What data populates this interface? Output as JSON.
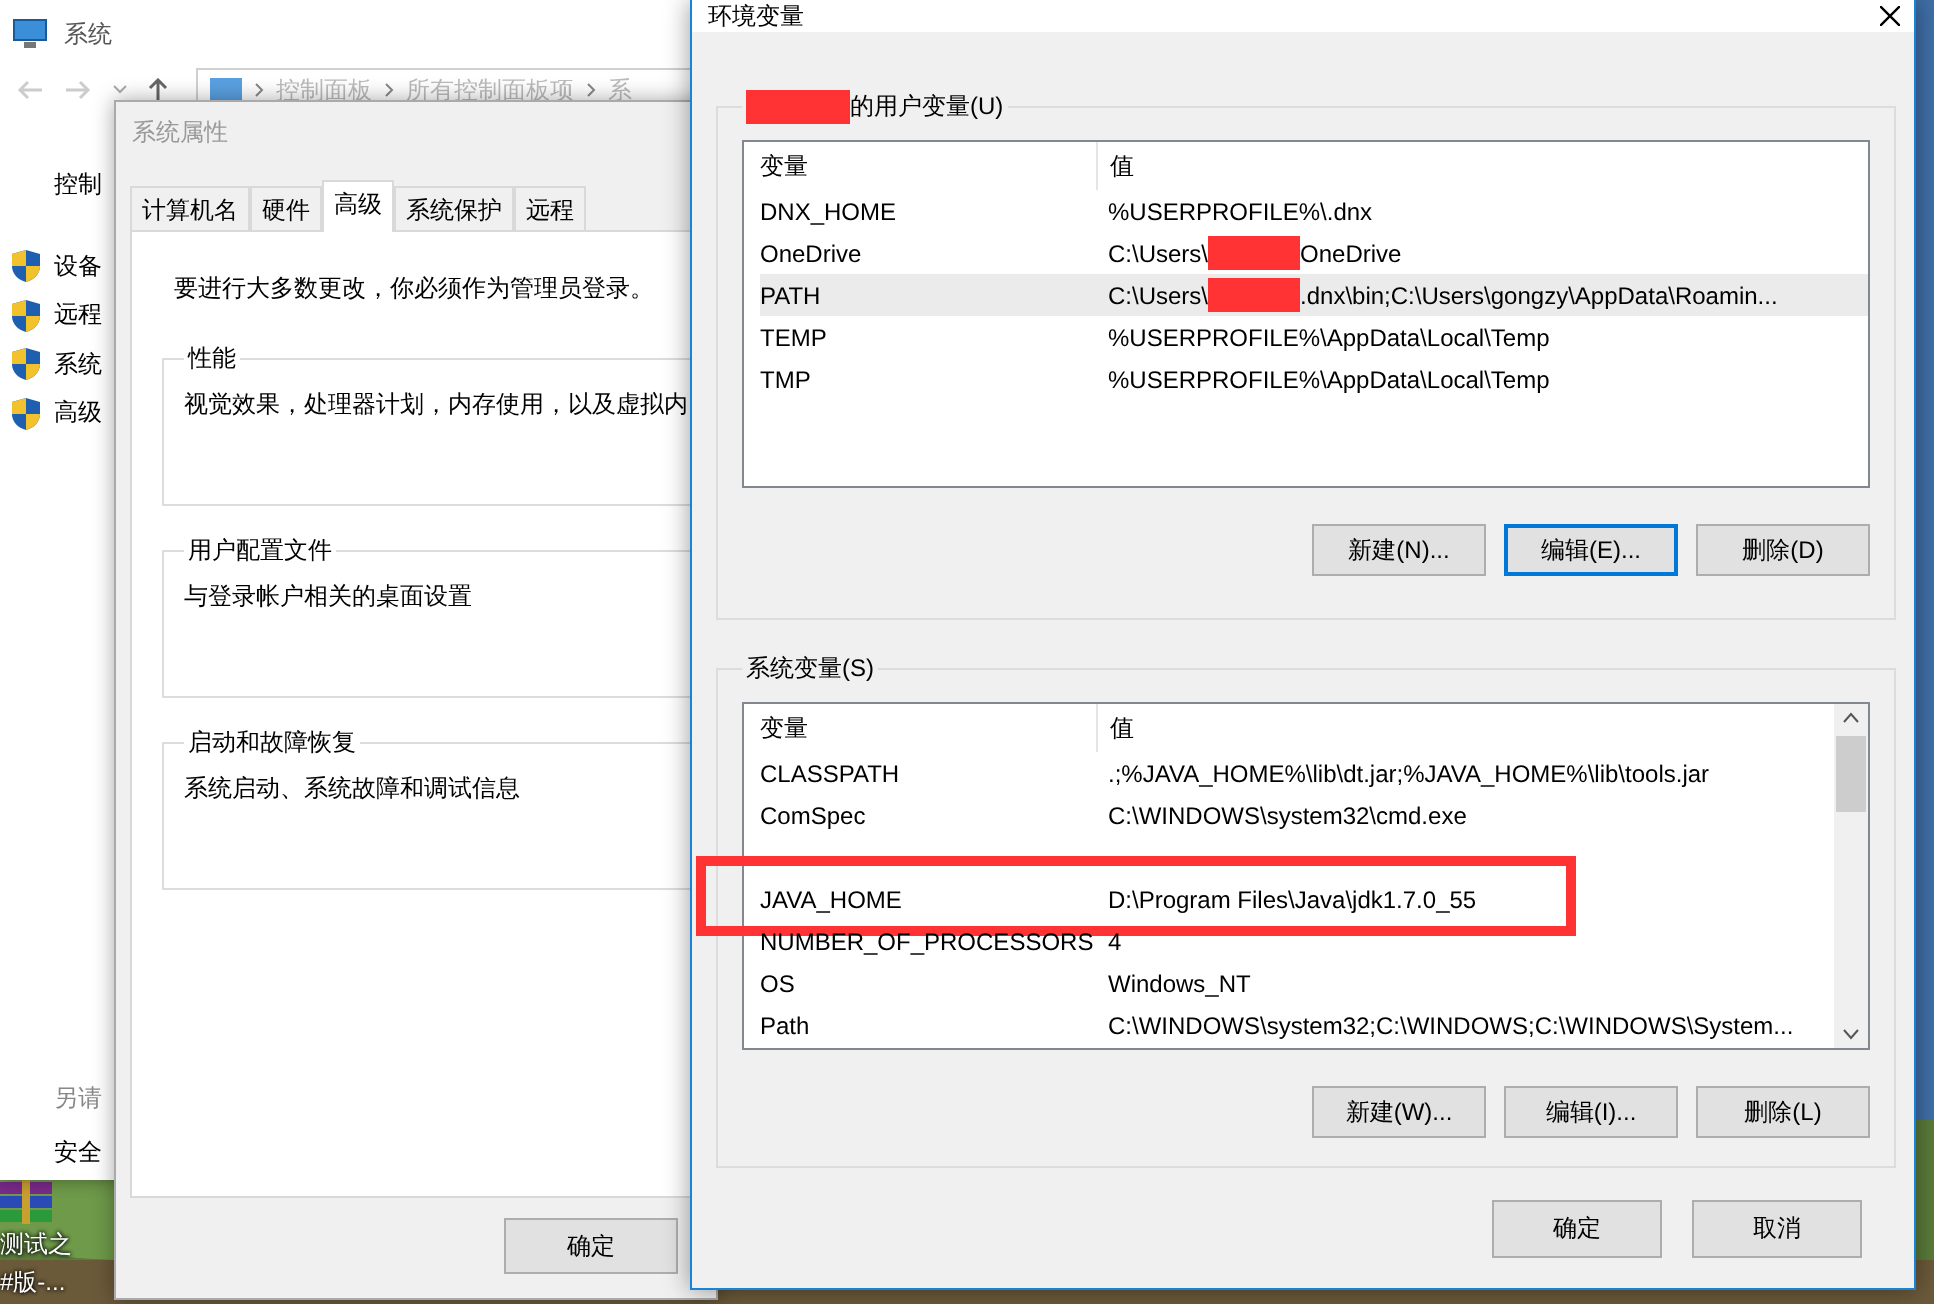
{
  "desktop": {
    "icons": [
      {
        "label": "测试之"
      },
      {
        "label": "#版-..."
      }
    ]
  },
  "control_panel": {
    "title": "系统",
    "breadcrumb": [
      "控制面板",
      "所有控制面板项",
      "系"
    ],
    "home_link": "控制",
    "tasks": [
      {
        "label": "设备"
      },
      {
        "label": "远程"
      },
      {
        "label": "系统"
      },
      {
        "label": "高级"
      }
    ],
    "see_also": {
      "heading": "另请",
      "links": [
        "安全"
      ]
    }
  },
  "system_properties": {
    "title": "系统属性",
    "tabs": [
      {
        "label": "计算机名",
        "selected": false
      },
      {
        "label": "硬件",
        "selected": false
      },
      {
        "label": "高级",
        "selected": true
      },
      {
        "label": "系统保护",
        "selected": false
      },
      {
        "label": "远程",
        "selected": false
      }
    ],
    "notice": "要进行大多数更改，你必须作为管理员登录。",
    "groups": [
      {
        "title": "性能",
        "text": "视觉效果，处理器计划，内存使用，以及虚拟内"
      },
      {
        "title": "用户配置文件",
        "text": "与登录帐户相关的桌面设置"
      },
      {
        "title": "启动和故障恢复",
        "text": "系统启动、系统故障和调试信息"
      }
    ],
    "buttons": [
      "确定"
    ]
  },
  "environment_variables": {
    "title": "环境变量",
    "user_variables": {
      "label": "的用户变量(U)",
      "label_redacted": true,
      "columns": [
        "变量",
        "值"
      ],
      "rows": [
        {
          "name": "DNX_HOME",
          "value": "%USERPROFILE%\\.dnx",
          "selected": false
        },
        {
          "name": "OneDrive",
          "value": "C:\\Users\\",
          "redacted": true,
          "value_tail": "OneDrive",
          "selected": false
        },
        {
          "name": "PATH",
          "value": "C:\\Users\\",
          "redacted": true,
          "value_tail": ".dnx\\bin;C:\\Users\\gongzy\\AppData\\Roamin...",
          "selected": true
        },
        {
          "name": "TEMP",
          "value": "%USERPROFILE%\\AppData\\Local\\Temp",
          "selected": false
        },
        {
          "name": "TMP",
          "value": "%USERPROFILE%\\AppData\\Local\\Temp",
          "selected": false
        }
      ],
      "buttons": [
        {
          "label": "新建(N)...",
          "focused": false
        },
        {
          "label": "编辑(E)...",
          "focused": true
        },
        {
          "label": "删除(D)",
          "focused": false
        }
      ]
    },
    "system_variables": {
      "label": "系统变量(S)",
      "columns": [
        "变量",
        "值"
      ],
      "rows": [
        {
          "name": "CLASSPATH",
          "value": ".;%JAVA_HOME%\\lib\\dt.jar;%JAVA_HOME%\\lib\\tools.jar",
          "selected": false,
          "highlighted": false
        },
        {
          "name": "ComSpec",
          "value": "C:\\WINDOWS\\system32\\cmd.exe",
          "selected": false,
          "highlighted": false
        },
        {
          "name": "JAVA_HOME",
          "value": "D:\\Program Files\\Java\\jdk1.7.0_55",
          "selected": false,
          "highlighted": true
        },
        {
          "name": "NUMBER_OF_PROCESSORS",
          "value": "4",
          "selected": false,
          "highlighted": false
        },
        {
          "name": "OS",
          "value": "Windows_NT",
          "selected": false,
          "highlighted": false
        },
        {
          "name": "Path",
          "value": "C:\\WINDOWS\\system32;C:\\WINDOWS;C:\\WINDOWS\\System...",
          "selected": false,
          "highlighted": false
        }
      ],
      "buttons": [
        {
          "label": "新建(W)...",
          "focused": false
        },
        {
          "label": "编辑(I)...",
          "focused": false
        },
        {
          "label": "删除(L)",
          "focused": false
        }
      ]
    },
    "buttons": [
      "确定",
      "取消"
    ]
  }
}
